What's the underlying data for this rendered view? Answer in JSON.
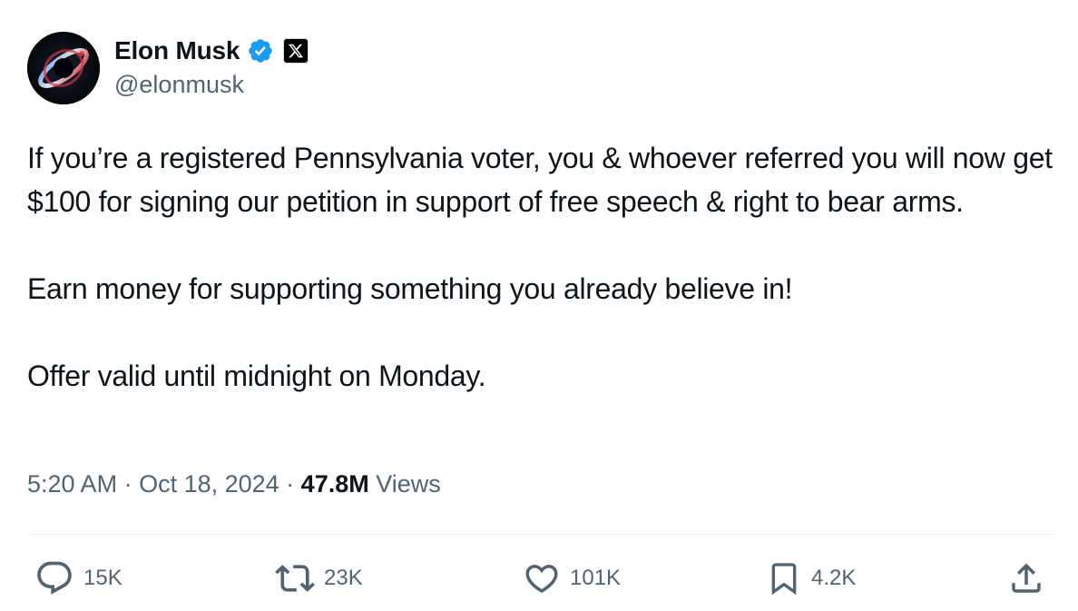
{
  "author": {
    "display_name": "Elon Musk",
    "handle": "@elonmusk",
    "verified": true,
    "affiliation": "X"
  },
  "tweet": {
    "paragraphs": [
      "If you’re a registered Pennsylvania voter, you & whoever referred you will now get $100 for signing our petition in support of free speech & right to bear arms.",
      "Earn money for supporting something you already believe in!",
      "Offer valid until midnight on Monday."
    ]
  },
  "meta": {
    "time": "5:20 AM",
    "separator": " · ",
    "date": "Oct 18, 2024",
    "views_count": "47.8M",
    "views_label": " Views"
  },
  "actions": {
    "replies": "15K",
    "reposts": "23K",
    "likes": "101K",
    "bookmarks": "4.2K"
  },
  "colors": {
    "text_primary": "#0f1419",
    "text_secondary": "#536471",
    "verified_blue": "#1d9bf0",
    "divider": "#eff3f4"
  },
  "icons": [
    "verified-icon",
    "x-logo-icon",
    "reply-icon",
    "repost-icon",
    "like-icon",
    "bookmark-icon",
    "share-icon"
  ]
}
